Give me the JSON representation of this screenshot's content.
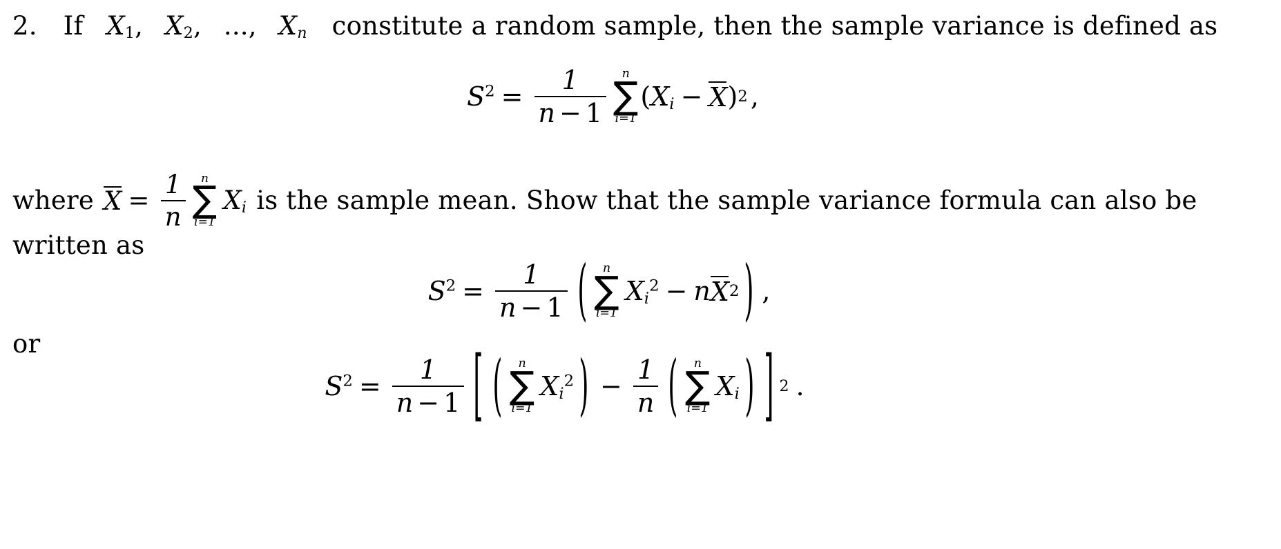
{
  "document": {
    "kind": "math-exercise",
    "background_color": "#ffffff",
    "text_color": "#000000"
  },
  "problem": {
    "number": "2.",
    "statement_parts": {
      "lead": "If",
      "var": "X",
      "sub1": "1",
      "sep1": ",",
      "sub2": "2",
      "sep2": ",",
      "ellipsis": "...,",
      "subn": "n",
      "tail": "constitute a random sample, then the sample variance is defined as"
    }
  },
  "equations": {
    "definition": {
      "lhs_symbol": "S",
      "lhs_exponent": "2",
      "equals": "=",
      "fraction_numerator": "1",
      "fraction_denominator_var": "n",
      "fraction_denominator_op": "−",
      "fraction_denominator_num": "1",
      "sum_glyph": "∑",
      "sum_upper": "n",
      "sum_lower": "i=1",
      "open_paren": "(",
      "term_var": "X",
      "term_sub": "i",
      "minus": "−",
      "mean_symbol": "X",
      "close_paren": ")",
      "exponent": "2",
      "punctuation": ","
    },
    "expanded": {
      "lhs_symbol": "S",
      "lhs_exponent": "2",
      "equals": "=",
      "fraction_numerator": "1",
      "fraction_denominator_var": "n",
      "fraction_denominator_op": "−",
      "fraction_denominator_num": "1",
      "open_paren": "(",
      "sum_glyph": "∑",
      "sum_upper": "n",
      "sum_lower": "i=1",
      "term_var": "X",
      "term_sub": "i",
      "term_sup": "2",
      "minus": "−",
      "coefficient": "n",
      "mean_symbol": "X",
      "mean_exponent": "2",
      "close_paren": ")",
      "punctuation": ","
    },
    "bracket": {
      "lhs_symbol": "S",
      "lhs_exponent": "2",
      "equals": "=",
      "fraction_numerator": "1",
      "fraction_denominator_var": "n",
      "fraction_denominator_op": "−",
      "fraction_denominator_num": "1",
      "open_bracket": "[",
      "open_paren_1": "(",
      "sum_glyph_1": "∑",
      "sum_upper_1": "n",
      "sum_lower_1": "i=1",
      "term_var_1": "X",
      "term_sub_1": "i",
      "term_sup_1": "2",
      "close_paren_1": ")",
      "minus": "−",
      "inner_frac_numerator": "1",
      "inner_frac_denominator": "n",
      "open_paren_2": "(",
      "sum_glyph_2": "∑",
      "sum_upper_2": "n",
      "sum_lower_2": "i=1",
      "term_var_2": "X",
      "term_sub_2": "i",
      "close_paren_2": ")",
      "outer_exponent": "2",
      "close_bracket": "]",
      "punctuation": "."
    }
  },
  "body": {
    "where_prefix": "where",
    "mean_symbol": "X",
    "equals": "=",
    "frac_num": "1",
    "frac_den": "n",
    "sum_glyph": "∑",
    "sum_upper": "n",
    "sum_lower": "i=1",
    "term_var": "X",
    "term_sub": "i",
    "where_tail": "is the sample mean.  Show that the sample variance formula can also be",
    "written_as": "written as",
    "or": "or"
  }
}
